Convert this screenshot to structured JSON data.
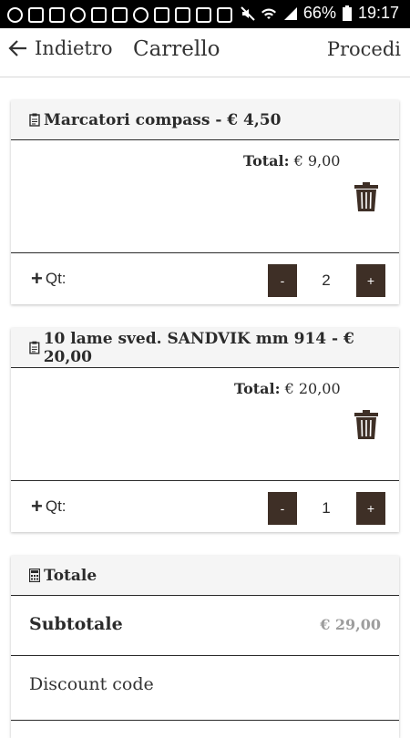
{
  "status_bar": {
    "battery": "66%",
    "time": "19:17"
  },
  "header": {
    "back_label": "Indietro",
    "title": "Carrello",
    "proceed_label": "Procedi"
  },
  "items": [
    {
      "title": "Marcatori compass - € 4,50",
      "total_label": "Total:",
      "total_value": "€ 9,00",
      "qty_label": "Qt:",
      "quantity": "2",
      "minus": "-",
      "plus": "+"
    },
    {
      "title": "10 lame sved. SANDVIK mm 914 - € 20,00",
      "total_label": "Total:",
      "total_value": "€ 20,00",
      "qty_label": "Qt:",
      "quantity": "1",
      "minus": "-",
      "plus": "+"
    }
  ],
  "totals": {
    "title": "Totale",
    "subtotal_label": "Subtotale",
    "subtotal_value": "€ 29,00",
    "discount_label": "Discount code"
  },
  "colors": {
    "stepper_bg": "#3e2f26",
    "subtotal_value": "#9d9d9d"
  }
}
